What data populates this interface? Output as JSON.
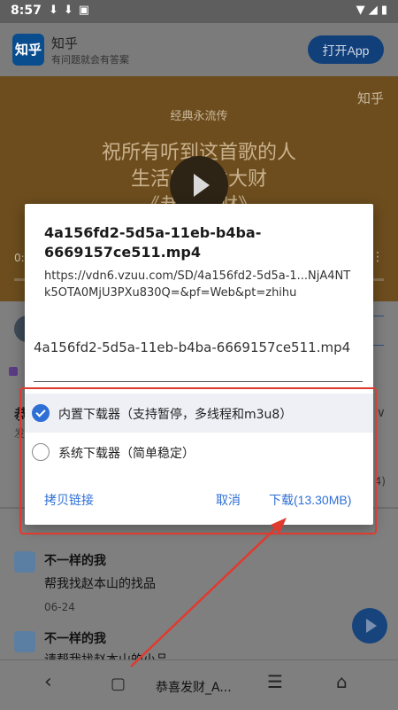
{
  "status_bar": {
    "time": "8:57"
  },
  "app_banner": {
    "logo": "知乎",
    "name": "知乎",
    "slogan": "有问题就会有答案",
    "open_button": "打开App"
  },
  "video": {
    "watermark": "知乎",
    "label": "经典永流传",
    "overlay_line1": "祝所有听到这首歌的人",
    "overlay_line2": "生活富足发大财",
    "overlay_line3": "《恭喜发财》",
    "time": "0:",
    "more": "⋮"
  },
  "page": {
    "headline": "恭",
    "sub": "发",
    "right_mark": "∨",
    "right_count": "4)",
    "comments": [
      {
        "user": "不一样的我",
        "text": "帮我找赵本山的找品",
        "date": "06-24"
      },
      {
        "user": "不一样的我",
        "text": "请帮我找赵本山的小品"
      }
    ]
  },
  "bottom_nav": {
    "title": "恭喜发财_A..."
  },
  "dialog": {
    "title": "4a156fd2-5d5a-11eb-b4ba-6669157ce511.mp4",
    "url": "https://vdn6.vzuu.com/SD/4a156fd2-5d5a-1...NjA4NTk5OTA0MjU3PXu830Q=&pf=Web&pt=zhihu",
    "filename": "4a156fd2-5d5a-11eb-b4ba-6669157ce511.mp4",
    "options": [
      {
        "label": "内置下载器（支持暂停，多线程和m3u8）",
        "selected": true
      },
      {
        "label": "系统下载器（简单稳定）",
        "selected": false
      }
    ],
    "copy_link": "拷贝链接",
    "cancel": "取消",
    "download": "下载(13.30MB)"
  },
  "colors": {
    "accent": "#2e6fd6",
    "highlight": "#e03a2f",
    "overlay": "#7f7f7f"
  }
}
